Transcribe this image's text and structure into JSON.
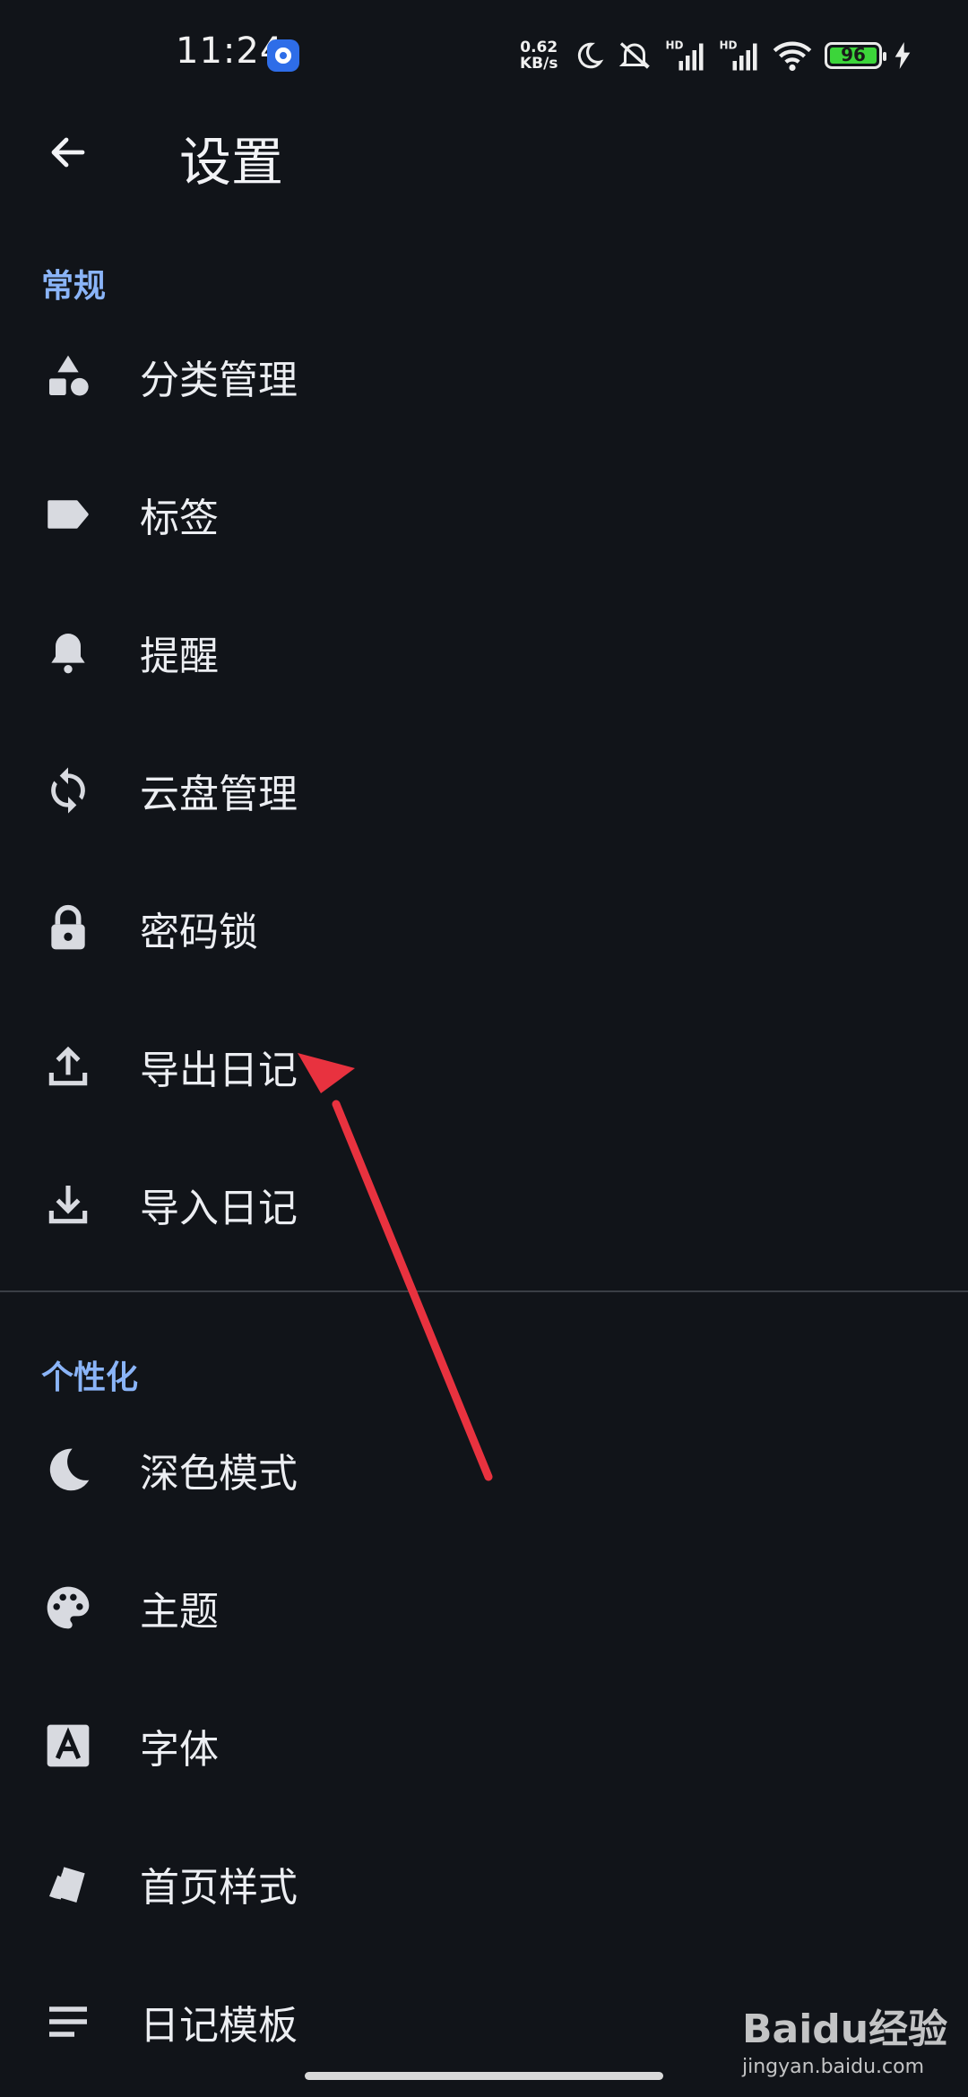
{
  "status_bar": {
    "time": "11:24",
    "net_speed_value": "0.62",
    "net_speed_unit": "KB/s",
    "battery": "96"
  },
  "header": {
    "title": "设置"
  },
  "sections": {
    "general": {
      "title": "常规",
      "items": [
        {
          "label": "分类管理",
          "icon": "category-icon"
        },
        {
          "label": "标签",
          "icon": "tag-icon"
        },
        {
          "label": "提醒",
          "icon": "bell-icon"
        },
        {
          "label": "云盘管理",
          "icon": "sync-icon"
        },
        {
          "label": "密码锁",
          "icon": "lock-icon"
        },
        {
          "label": "导出日记",
          "icon": "upload-icon"
        },
        {
          "label": "导入日记",
          "icon": "download-icon"
        }
      ]
    },
    "personalize": {
      "title": "个性化",
      "items": [
        {
          "label": "深色模式",
          "icon": "moon-icon"
        },
        {
          "label": "主题",
          "icon": "palette-icon"
        },
        {
          "label": "字体",
          "icon": "font-icon"
        },
        {
          "label": "首页样式",
          "icon": "cards-icon"
        },
        {
          "label": "日记模板",
          "icon": "notes-icon"
        }
      ]
    }
  },
  "watermark": {
    "brand": "Baidu经验",
    "url": "jingyan.baidu.com"
  },
  "colors": {
    "background": "#111419",
    "accent": "#8ab4f8",
    "annotation_arrow": "#e8323f"
  }
}
